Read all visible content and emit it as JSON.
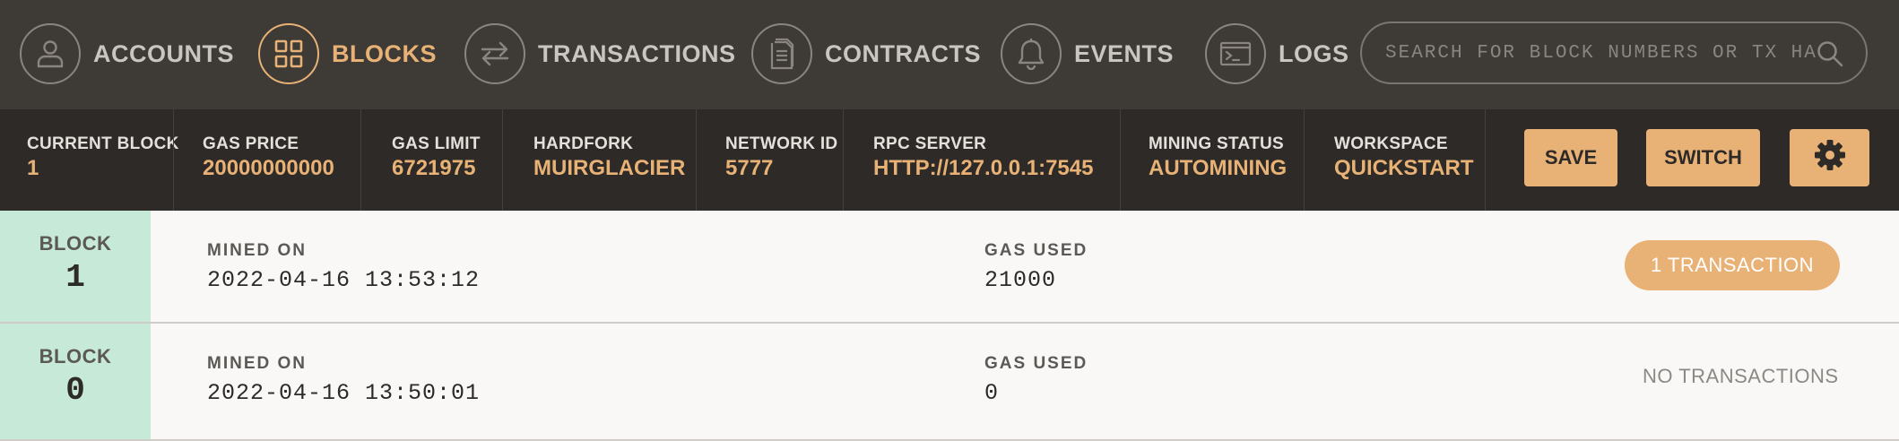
{
  "nav": {
    "items": [
      {
        "label": "ACCOUNTS",
        "icon": "user-icon",
        "active": false
      },
      {
        "label": "BLOCKS",
        "icon": "grid-icon",
        "active": true
      },
      {
        "label": "TRANSACTIONS",
        "icon": "swap-arrows-icon",
        "active": false
      },
      {
        "label": "CONTRACTS",
        "icon": "document-icon",
        "active": false
      },
      {
        "label": "EVENTS",
        "icon": "bell-icon",
        "active": false
      },
      {
        "label": "LOGS",
        "icon": "terminal-icon",
        "active": false
      }
    ],
    "search_placeholder": "SEARCH FOR BLOCK NUMBERS OR TX HASHES"
  },
  "status": {
    "current_block": {
      "label": "CURRENT BLOCK",
      "value": "1"
    },
    "gas_price": {
      "label": "GAS PRICE",
      "value": "20000000000"
    },
    "gas_limit": {
      "label": "GAS LIMIT",
      "value": "6721975"
    },
    "hardfork": {
      "label": "HARDFORK",
      "value": "MUIRGLACIER"
    },
    "network_id": {
      "label": "NETWORK ID",
      "value": "5777"
    },
    "rpc_server": {
      "label": "RPC SERVER",
      "value": "HTTP://127.0.0.1:7545"
    },
    "mining_status": {
      "label": "MINING STATUS",
      "value": "AUTOMINING"
    },
    "workspace": {
      "label": "WORKSPACE",
      "value": "QUICKSTART"
    },
    "save_label": "SAVE",
    "switch_label": "SWITCH",
    "settings_icon": "gear-icon"
  },
  "blocks": [
    {
      "block_label": "BLOCK",
      "number": "1",
      "mined_on_label": "MINED ON",
      "mined_on": "2022-04-16 13:53:12",
      "gas_used_label": "GAS USED",
      "gas_used": "21000",
      "transactions": "1 TRANSACTION"
    },
    {
      "block_label": "BLOCK",
      "number": "0",
      "mined_on_label": "MINED ON",
      "mined_on": "2022-04-16 13:50:01",
      "gas_used_label": "GAS USED",
      "gas_used": "0",
      "transactions": "NO TRANSACTIONS"
    }
  ],
  "colors": {
    "accent": "#e8b276",
    "nav_bg": "#3e3a36",
    "status_bg": "#2e2a27",
    "block_number_bg": "#c7ead8"
  }
}
